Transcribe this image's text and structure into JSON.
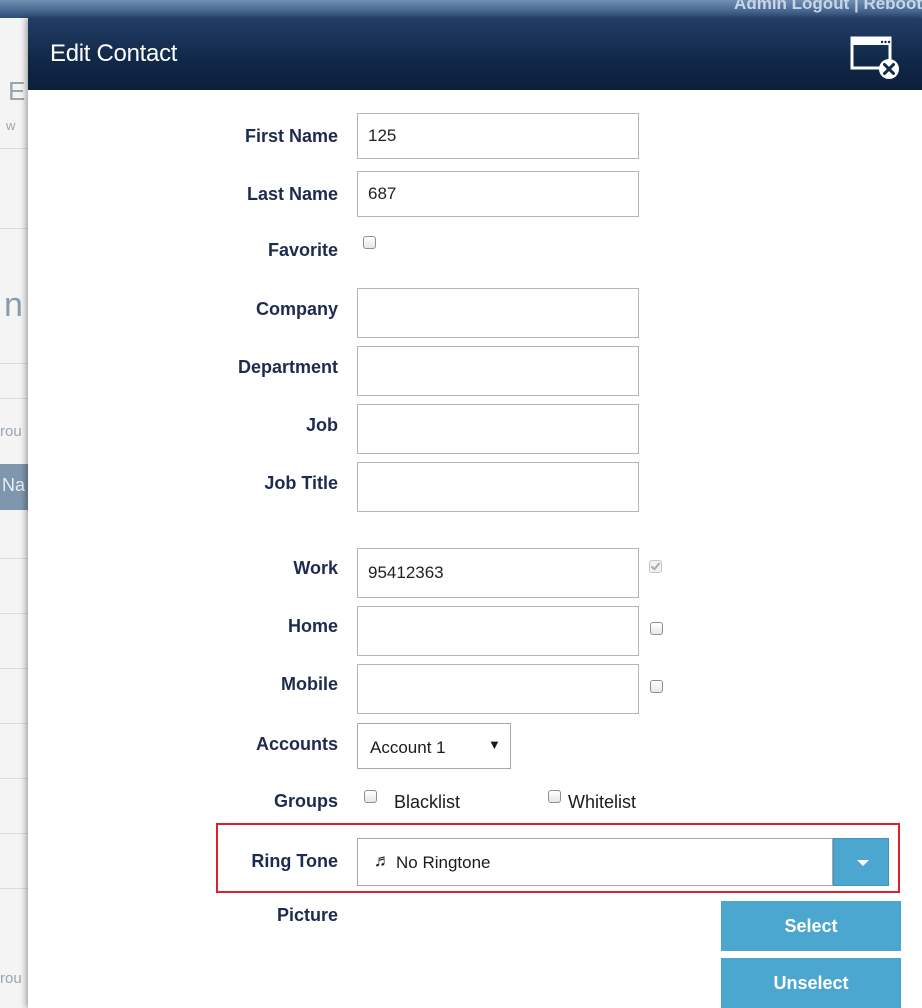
{
  "background": {
    "top_links": "Admin Logout | Reboot",
    "fragments": [
      "E",
      "w",
      "n",
      "rou",
      "Na",
      "rou"
    ]
  },
  "dialog": {
    "title": "Edit Contact",
    "close_icon": "window-close-icon"
  },
  "form": {
    "first_name": {
      "label": "First Name",
      "value": "125"
    },
    "last_name": {
      "label": "Last Name",
      "value": "687"
    },
    "favorite": {
      "label": "Favorite",
      "checked": false
    },
    "company": {
      "label": "Company",
      "value": ""
    },
    "department": {
      "label": "Department",
      "value": ""
    },
    "job": {
      "label": "Job",
      "value": ""
    },
    "job_title": {
      "label": "Job Title",
      "value": ""
    },
    "work": {
      "label": "Work",
      "value": "95412363",
      "default": true
    },
    "home": {
      "label": "Home",
      "value": "",
      "default": false
    },
    "mobile": {
      "label": "Mobile",
      "value": "",
      "default": false
    },
    "accounts": {
      "label": "Accounts",
      "selected": "Account 1"
    },
    "groups": {
      "label": "Groups",
      "options": [
        {
          "label": "Blacklist",
          "checked": false
        },
        {
          "label": "Whitelist",
          "checked": false
        }
      ]
    },
    "ring_tone": {
      "label": "Ring Tone",
      "value": "No Ringtone",
      "icon": "music-note-icon"
    },
    "picture": {
      "label": "Picture",
      "select_label": "Select",
      "unselect_label": "Unselect"
    }
  },
  "colors": {
    "title_bar": "#11294a",
    "label_text": "#1d2b4f",
    "accent_button": "#4ba7d0",
    "highlight_border": "#d9222a"
  }
}
